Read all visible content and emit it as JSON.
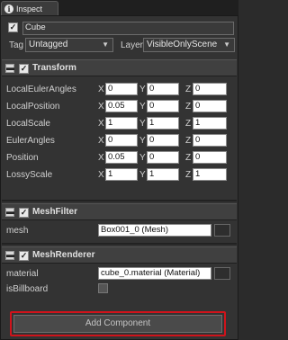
{
  "tab": {
    "icon": "info-icon",
    "label": "Inspect"
  },
  "object": {
    "active": true,
    "name": "Cube"
  },
  "tag": {
    "label": "Tag",
    "value": "Untagged"
  },
  "layer": {
    "label": "Layer",
    "value": "VisibleOnlyScene"
  },
  "transform": {
    "title": "Transform",
    "rows": [
      {
        "label": "LocalEulerAngles",
        "x": "0",
        "y": "0",
        "z": "0"
      },
      {
        "label": "LocalPosition",
        "x": "0.05",
        "y": "0",
        "z": "0"
      },
      {
        "label": "LocalScale",
        "x": "1",
        "y": "1",
        "z": "1"
      },
      {
        "label": "EulerAngles",
        "x": "0",
        "y": "0",
        "z": "0"
      },
      {
        "label": "Position",
        "x": "0.05",
        "y": "0",
        "z": "0"
      },
      {
        "label": "LossyScale",
        "x": "1",
        "y": "1",
        "z": "1"
      }
    ]
  },
  "axis_labels": {
    "x": "X",
    "y": "Y",
    "z": "Z"
  },
  "mesh_filter": {
    "title": "MeshFilter",
    "mesh_label": "mesh",
    "mesh_value": "Box001_0 (Mesh)"
  },
  "mesh_renderer": {
    "title": "MeshRenderer",
    "material_label": "material",
    "material_value": "cube_0.material (Material)",
    "billboard_label": "isBillboard"
  },
  "add_component": {
    "label": "Add Component"
  }
}
